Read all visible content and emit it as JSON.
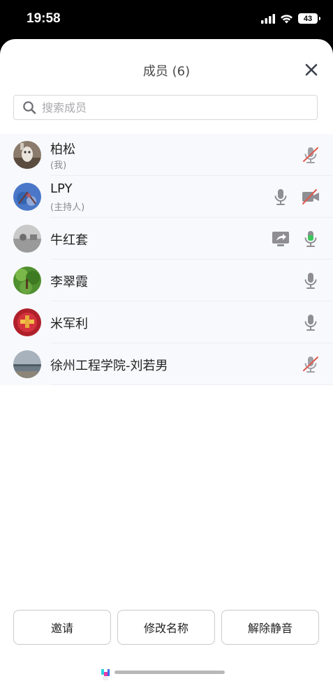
{
  "status_bar": {
    "time": "19:58",
    "battery": "43"
  },
  "sheet": {
    "title": "成员 (6)",
    "search_placeholder": "搜索成员"
  },
  "members": [
    {
      "name": "柏松",
      "sub": "(我)"
    },
    {
      "name": "LPY",
      "sub": "(主持人)"
    },
    {
      "name": "牛红套",
      "sub": ""
    },
    {
      "name": "李翠霞",
      "sub": ""
    },
    {
      "name": "米军利",
      "sub": ""
    },
    {
      "name": "徐州工程学院-刘若男",
      "sub": ""
    }
  ],
  "buttons": {
    "invite": "邀请",
    "rename": "修改名称",
    "unmute": "解除静音"
  },
  "colors": {
    "mic_gray": "#8e8e93",
    "mic_active": "#3cc75a",
    "muted_slash": "#e0584a",
    "sheet_bg": "#ffffff",
    "row_bg": "#f8f9fc"
  }
}
